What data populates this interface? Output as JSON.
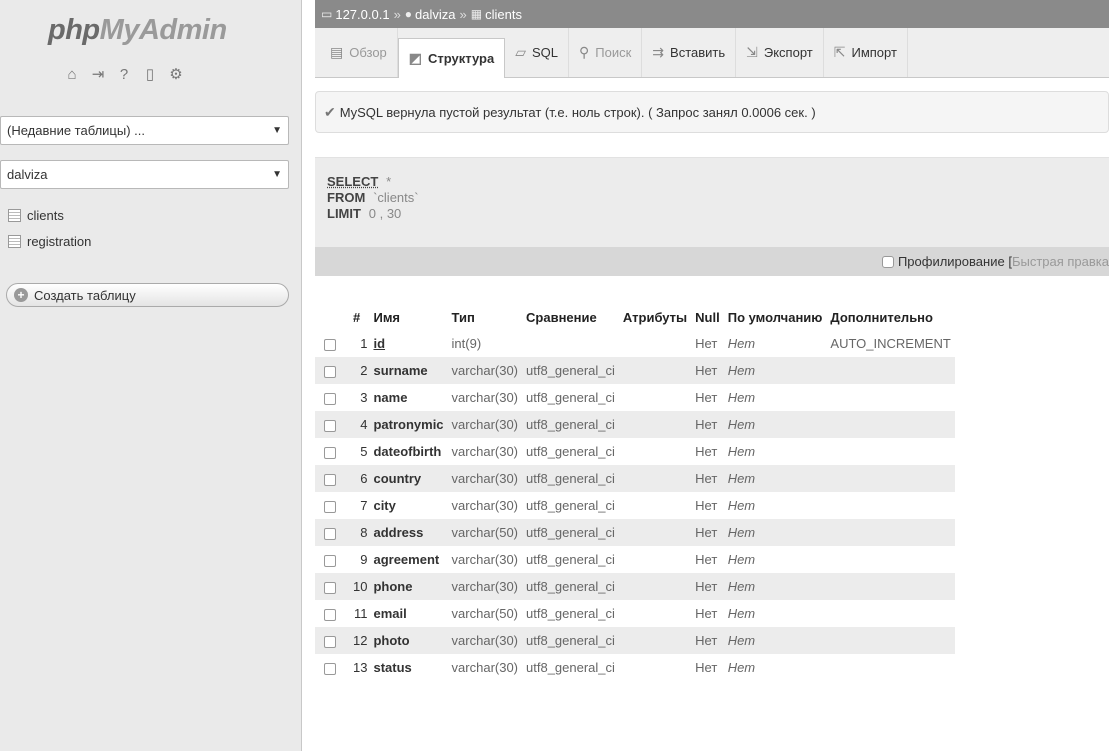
{
  "nav": {
    "logo_php": "php",
    "logo_myadmin": "MyAdmin",
    "recent_tables_label": "(Недавние таблицы) ...",
    "database_label": "dalviza",
    "tables": [
      {
        "name": "clients"
      },
      {
        "name": "registration"
      }
    ],
    "create_table_label": "Создать таблицу"
  },
  "breadcrumb": {
    "server": "127.0.0.1",
    "database": "dalviza",
    "table": "clients",
    "separator": "»"
  },
  "tabs": [
    {
      "label": "Обзор",
      "icon": "browse-icon",
      "state": "muted"
    },
    {
      "label": "Структура",
      "icon": "structure-icon",
      "state": "active"
    },
    {
      "label": "SQL",
      "icon": "sql-icon",
      "state": "normal"
    },
    {
      "label": "Поиск",
      "icon": "search-icon",
      "state": "muted"
    },
    {
      "label": "Вставить",
      "icon": "insert-icon",
      "state": "normal"
    },
    {
      "label": "Экспорт",
      "icon": "export-icon",
      "state": "normal"
    },
    {
      "label": "Импорт",
      "icon": "import-icon",
      "state": "normal"
    }
  ],
  "message": "MySQL вернула пустой результат (т.е. ноль строк). ( Запрос занял 0.0006 сек. )",
  "query": {
    "select_kw": "SELECT",
    "select_val": "*",
    "from_kw": "FROM",
    "from_val": "`clients`",
    "limit_kw": "LIMIT",
    "limit_val": "0 , 30"
  },
  "profiling": {
    "label": "Профилирование",
    "bracket": "[",
    "quick_edit": "Быстрая правка"
  },
  "table": {
    "headers": [
      "#",
      "Имя",
      "Тип",
      "Сравнение",
      "Атрибуты",
      "Null",
      "По умолчанию",
      "Дополнительно"
    ],
    "rows": [
      {
        "num": "1",
        "name": "id",
        "type": "int(9)",
        "collation": "",
        "attributes": "",
        "null": "Нет",
        "default": "Нет",
        "extra": "AUTO_INCREMENT"
      },
      {
        "num": "2",
        "name": "surname",
        "type": "varchar(30)",
        "collation": "utf8_general_ci",
        "attributes": "",
        "null": "Нет",
        "default": "Нет",
        "extra": ""
      },
      {
        "num": "3",
        "name": "name",
        "type": "varchar(30)",
        "collation": "utf8_general_ci",
        "attributes": "",
        "null": "Нет",
        "default": "Нет",
        "extra": ""
      },
      {
        "num": "4",
        "name": "patronymic",
        "type": "varchar(30)",
        "collation": "utf8_general_ci",
        "attributes": "",
        "null": "Нет",
        "default": "Нет",
        "extra": ""
      },
      {
        "num": "5",
        "name": "dateofbirth",
        "type": "varchar(30)",
        "collation": "utf8_general_ci",
        "attributes": "",
        "null": "Нет",
        "default": "Нет",
        "extra": ""
      },
      {
        "num": "6",
        "name": "country",
        "type": "varchar(30)",
        "collation": "utf8_general_ci",
        "attributes": "",
        "null": "Нет",
        "default": "Нет",
        "extra": ""
      },
      {
        "num": "7",
        "name": "city",
        "type": "varchar(30)",
        "collation": "utf8_general_ci",
        "attributes": "",
        "null": "Нет",
        "default": "Нет",
        "extra": ""
      },
      {
        "num": "8",
        "name": "address",
        "type": "varchar(50)",
        "collation": "utf8_general_ci",
        "attributes": "",
        "null": "Нет",
        "default": "Нет",
        "extra": ""
      },
      {
        "num": "9",
        "name": "agreement",
        "type": "varchar(30)",
        "collation": "utf8_general_ci",
        "attributes": "",
        "null": "Нет",
        "default": "Нет",
        "extra": ""
      },
      {
        "num": "10",
        "name": "phone",
        "type": "varchar(30)",
        "collation": "utf8_general_ci",
        "attributes": "",
        "null": "Нет",
        "default": "Нет",
        "extra": ""
      },
      {
        "num": "11",
        "name": "email",
        "type": "varchar(50)",
        "collation": "utf8_general_ci",
        "attributes": "",
        "null": "Нет",
        "default": "Нет",
        "extra": ""
      },
      {
        "num": "12",
        "name": "photo",
        "type": "varchar(30)",
        "collation": "utf8_general_ci",
        "attributes": "",
        "null": "Нет",
        "default": "Нет",
        "extra": ""
      },
      {
        "num": "13",
        "name": "status",
        "type": "varchar(30)",
        "collation": "utf8_general_ci",
        "attributes": "",
        "null": "Нет",
        "default": "Нет",
        "extra": ""
      }
    ]
  }
}
